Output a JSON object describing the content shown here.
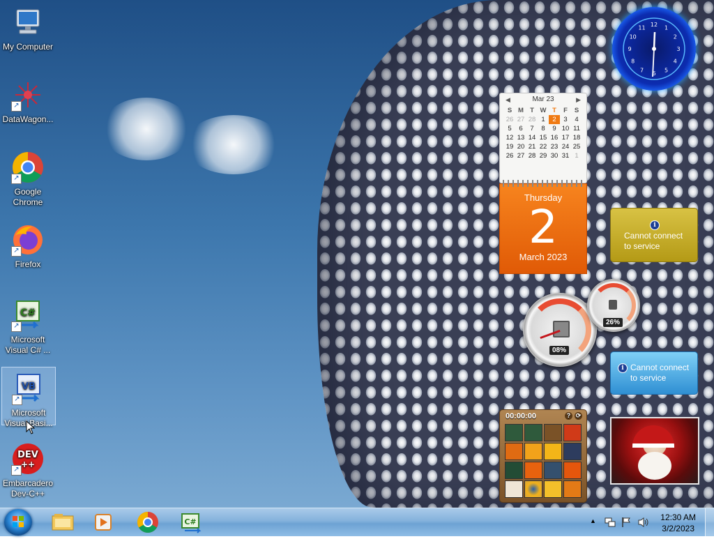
{
  "desktop": {
    "icons": [
      {
        "label": "My Computer",
        "icon": "computer-icon"
      },
      {
        "label": "DataWagon...",
        "icon": "datawagon-icon"
      },
      {
        "label": "Google Chrome",
        "icon": "chrome-icon"
      },
      {
        "label": "Firefox",
        "icon": "firefox-icon"
      },
      {
        "label": "Microsoft Visual C# ...",
        "icon": "visual-csharp-icon"
      },
      {
        "label": "Microsoft Visual Basi...",
        "icon": "visual-basic-icon"
      },
      {
        "label": "Embarcadero Dev-C++",
        "icon": "devcpp-icon"
      }
    ]
  },
  "gadgets": {
    "clock": {
      "numbers": [
        "12",
        "1",
        "2",
        "3",
        "4",
        "5",
        "6",
        "7",
        "8",
        "9",
        "10",
        "11"
      ]
    },
    "calendar": {
      "month_label": "Mar 23",
      "weekdays": [
        "S",
        "M",
        "T",
        "W",
        "T",
        "F",
        "S"
      ],
      "weeks": [
        [
          "26",
          "27",
          "28",
          "1",
          "2",
          "3",
          "4"
        ],
        [
          "5",
          "6",
          "7",
          "8",
          "9",
          "10",
          "11"
        ],
        [
          "12",
          "13",
          "14",
          "15",
          "16",
          "17",
          "18"
        ],
        [
          "19",
          "20",
          "21",
          "22",
          "23",
          "24",
          "25"
        ],
        [
          "26",
          "27",
          "28",
          "29",
          "30",
          "31",
          "1"
        ]
      ],
      "weekday_name": "Thursday",
      "day": "2",
      "month_year": "March 2023"
    },
    "weather_top": {
      "message": "Cannot connect to service"
    },
    "weather_bottom": {
      "message": "Cannot connect to service"
    },
    "cpu_meter": {
      "cpu_percent": "08%",
      "memory_percent": "26%"
    },
    "puzzle": {
      "timer": "00:00:00"
    }
  },
  "taskbar": {
    "pinned": [
      {
        "name": "windows-explorer-icon"
      },
      {
        "name": "media-player-icon"
      },
      {
        "name": "chrome-icon"
      },
      {
        "name": "visual-csharp-icon"
      }
    ],
    "clock": {
      "time": "12:30 AM",
      "date": "3/2/2023"
    }
  },
  "colors": {
    "accent": "#f07a12",
    "taskbar": "#84b2dc"
  }
}
